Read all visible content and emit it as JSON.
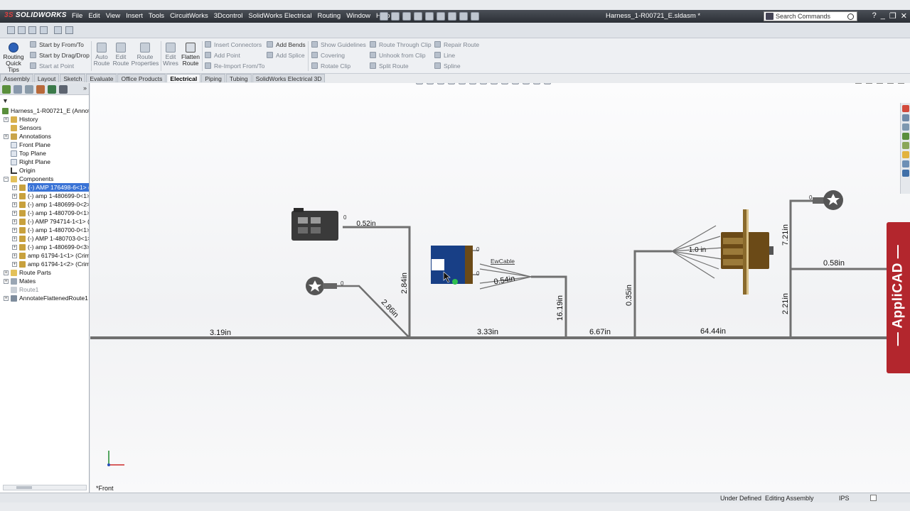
{
  "app": {
    "logo_prefix": "3S",
    "logo_name": "SOLIDWORKS",
    "doc_title": "Harness_1-R00721_E.sldasm *"
  },
  "menu": [
    "File",
    "Edit",
    "View",
    "Insert",
    "Tools",
    "CircuitWorks",
    "3Dcontrol",
    "SolidWorks Electrical",
    "Routing",
    "Window",
    "Help"
  ],
  "search": {
    "placeholder": "Search Commands"
  },
  "window_controls": [
    "?",
    "_",
    "❐",
    "✕"
  ],
  "commands": {
    "routing_quick_tips": "Routing Quick Tips",
    "start_from_to": "Start by From/To",
    "start_drag_drop": "Start by Drag/Drop",
    "start_at_point": "Start at Point",
    "auto_route": "Auto Route",
    "edit_route": "Edit Route",
    "route_properties": "Route Properties",
    "edit_wires": "Edit Wires",
    "flatten_route": "Flatten Route",
    "insert_connectors": "Insert Connectors",
    "add_point": "Add Point",
    "reimport": "Re-Import From/To",
    "add_bends": "Add Bends",
    "add_splice": "Add Splice",
    "show_guidelines": "Show Guidelines",
    "covering": "Covering",
    "rotate_clip": "Rotate Clip",
    "route_through_clip": "Route Through Clip",
    "unhook_from_clip": "Unhook from Clip",
    "split_route": "Split Route",
    "repair_route": "Repair Route",
    "line": "Line",
    "spline": "Spline"
  },
  "tabs": [
    {
      "label": "Assembly"
    },
    {
      "label": "Layout"
    },
    {
      "label": "Sketch"
    },
    {
      "label": "Evaluate"
    },
    {
      "label": "Office Products"
    },
    {
      "label": "Electrical"
    },
    {
      "label": "Piping"
    },
    {
      "label": "Tubing"
    },
    {
      "label": "SolidWorks Electrical 3D"
    }
  ],
  "tree": {
    "root": "Harness_1-R00721_E  (Annotate",
    "history": "History",
    "sensors": "Sensors",
    "annotations": "Annotations",
    "front_plane": "Front Plane",
    "top_plane": "Top Plane",
    "right_plane": "Right Plane",
    "origin": "Origin",
    "components": "Components",
    "items": [
      "(-) AMP 176498-6<1> (D",
      "(-) amp 1-480699-0<1>",
      "(-) amp 1-480699-0<2>",
      "(-) amp 1-480709-0<1>",
      "(-) AMP 794714-1<1> (D",
      "(-) amp 1-480700-0<1>",
      "(-) AMP 1-480703-0<1>",
      "(-) amp 1-480699-0<3>",
      "amp 61794-1<1> (Crimp",
      "amp 61794-1<2> (Crimp"
    ],
    "route_parts": "Route Parts",
    "mates": "Mates",
    "route1": "Route1",
    "annotate_flattened": "AnnotateFlattenedRoute1"
  },
  "drawing": {
    "dims": {
      "d_319": "3.19in",
      "d_284": "2.84in",
      "d_286": "2.86in",
      "d_052": "0.52in",
      "d_333": "3.33in",
      "d_054": "0.54in",
      "d_1619": "16.19in",
      "d_667": "6.67in",
      "d_035": "0.35in",
      "d_6444": "64.44in",
      "d_721": "7.21in",
      "d_221": "2.21in",
      "d_058": "0.58in",
      "d_10": "1.0 in"
    },
    "cable_label": "EwCable",
    "pin_label": "0"
  },
  "view_name": "*Front",
  "applicad": "— AppliCAD —",
  "status": {
    "under_defined": "Under Defined",
    "editing": "Editing Assembly",
    "units": "IPS"
  },
  "colors": {
    "accent": "#2c61b8",
    "applicad": "#b3262d",
    "connector_blue": "#183f86",
    "connector_brown": "#6b4a17"
  }
}
